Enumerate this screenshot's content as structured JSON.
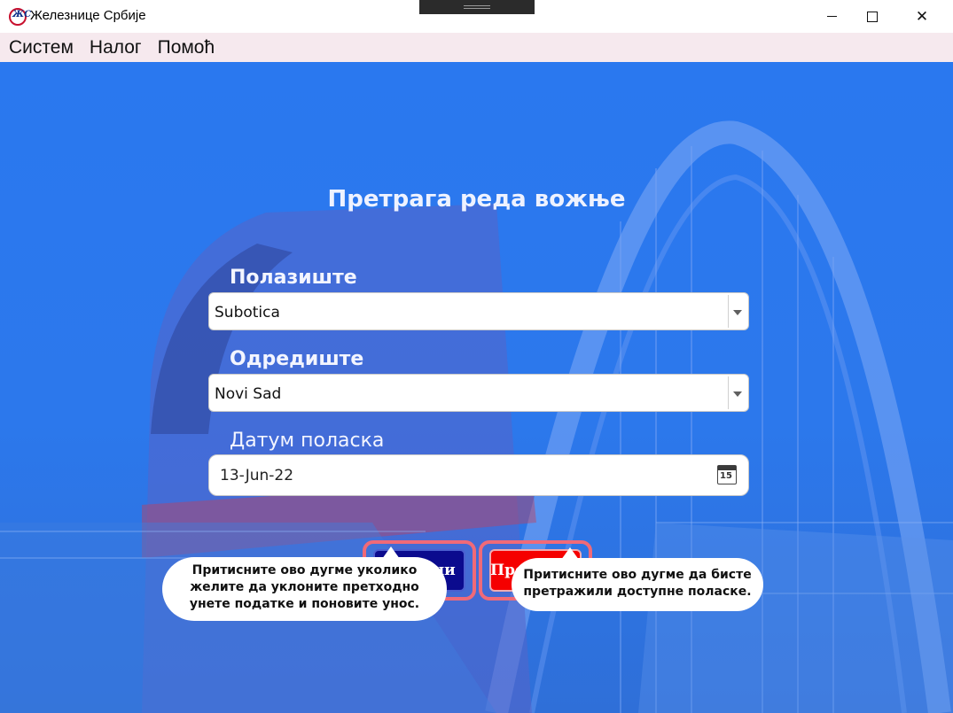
{
  "window": {
    "title": "Железнице Србије",
    "logo_text": "ЖС"
  },
  "menu": {
    "items": [
      "Систем",
      "Налог",
      "Помоћ"
    ]
  },
  "form": {
    "heading": "Претрага реда вожње",
    "origin_label": "Полазиште",
    "origin_value": "Subotica",
    "destination_label": "Одредиште",
    "destination_value": "Novi Sad",
    "date_label": "Датум поласка",
    "date_value": "13-Jun-22",
    "calendar_day": "15"
  },
  "buttons": {
    "clear_label": "Обриши",
    "search_label": "Претражи"
  },
  "tooltips": {
    "clear_help": [
      "Притисните ово дугме уколико",
      "желите да уклоните претходно",
      "унете податке и поновите унос."
    ],
    "search_help": [
      "Притисните ово дугме да бисте",
      "претражили доступне поласке."
    ]
  },
  "colors": {
    "background_blue": "#2a78ef",
    "clear_button": "#0b0b8e",
    "search_button": "#f50000",
    "highlight_outline": "#f06a78",
    "menu_bar": "#f6e9ee"
  }
}
